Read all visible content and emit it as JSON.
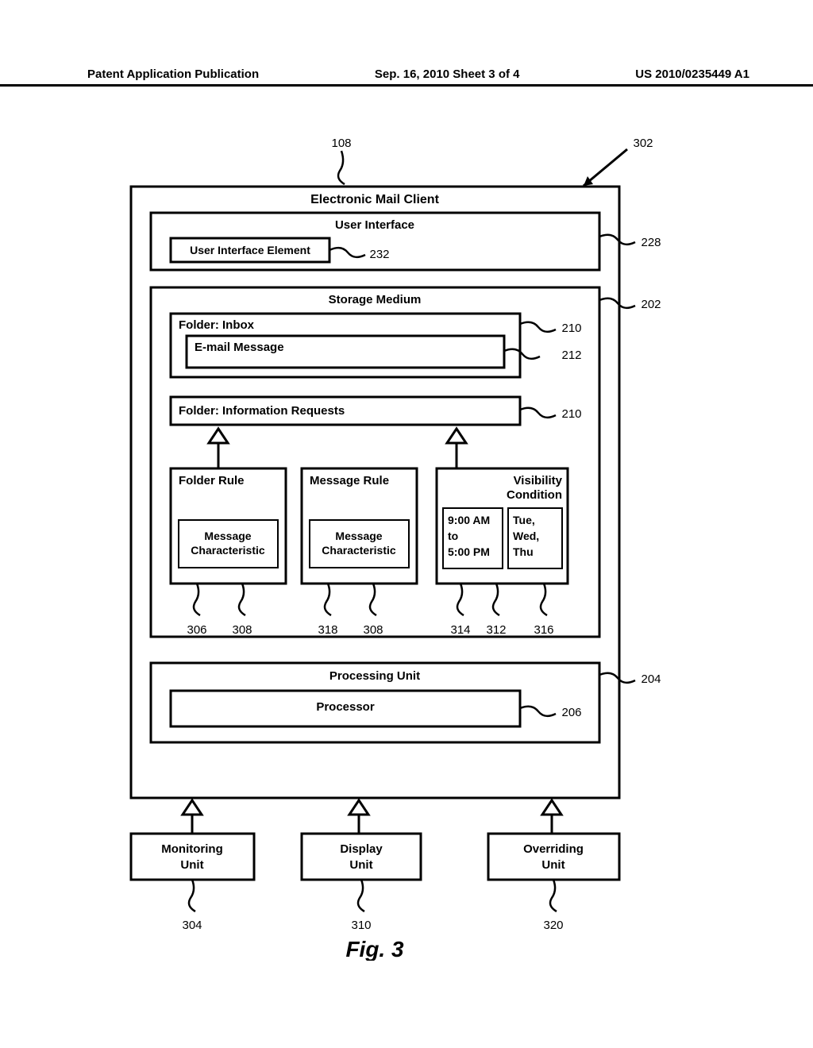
{
  "header": {
    "left": "Patent Application Publication",
    "mid": "Sep. 16, 2010  Sheet 3 of 4",
    "right": "US 2010/0235449 A1"
  },
  "refs": {
    "r108": "108",
    "r302": "302",
    "r228": "228",
    "r232": "232",
    "r202": "202",
    "r210a": "210",
    "r212": "212",
    "r210b": "210",
    "r306": "306",
    "r308a": "308",
    "r318": "318",
    "r308b": "308",
    "r314": "314",
    "r312": "312",
    "r316": "316",
    "r204": "204",
    "r206": "206",
    "r304": "304",
    "r310": "310",
    "r320": "320"
  },
  "labels": {
    "mailClient": "Electronic Mail Client",
    "userInterface": "User Interface",
    "uiElement": "User Interface Element",
    "storageMedium": "Storage Medium",
    "folderInbox": "Folder: Inbox",
    "emailMessage": "E-mail Message",
    "folderInfo": "Folder: Information Requests",
    "folderRule": "Folder Rule",
    "messageRule": "Message Rule",
    "msgChar1": "Message",
    "msgChar2": "Characteristic",
    "visCond1": "Visibility",
    "visCond2": "Condition",
    "time1": "9:00 AM",
    "time2": "to",
    "time3": "5:00 PM",
    "day1": "Tue,",
    "day2": "Wed,",
    "day3": "Thu",
    "procUnit": "Processing Unit",
    "processor": "Processor",
    "monUnit1": "Monitoring",
    "monUnit2": "Unit",
    "dispUnit1": "Display",
    "dispUnit2": "Unit",
    "ovrUnit1": "Overriding",
    "ovrUnit2": "Unit",
    "fig": "Fig. 3"
  }
}
